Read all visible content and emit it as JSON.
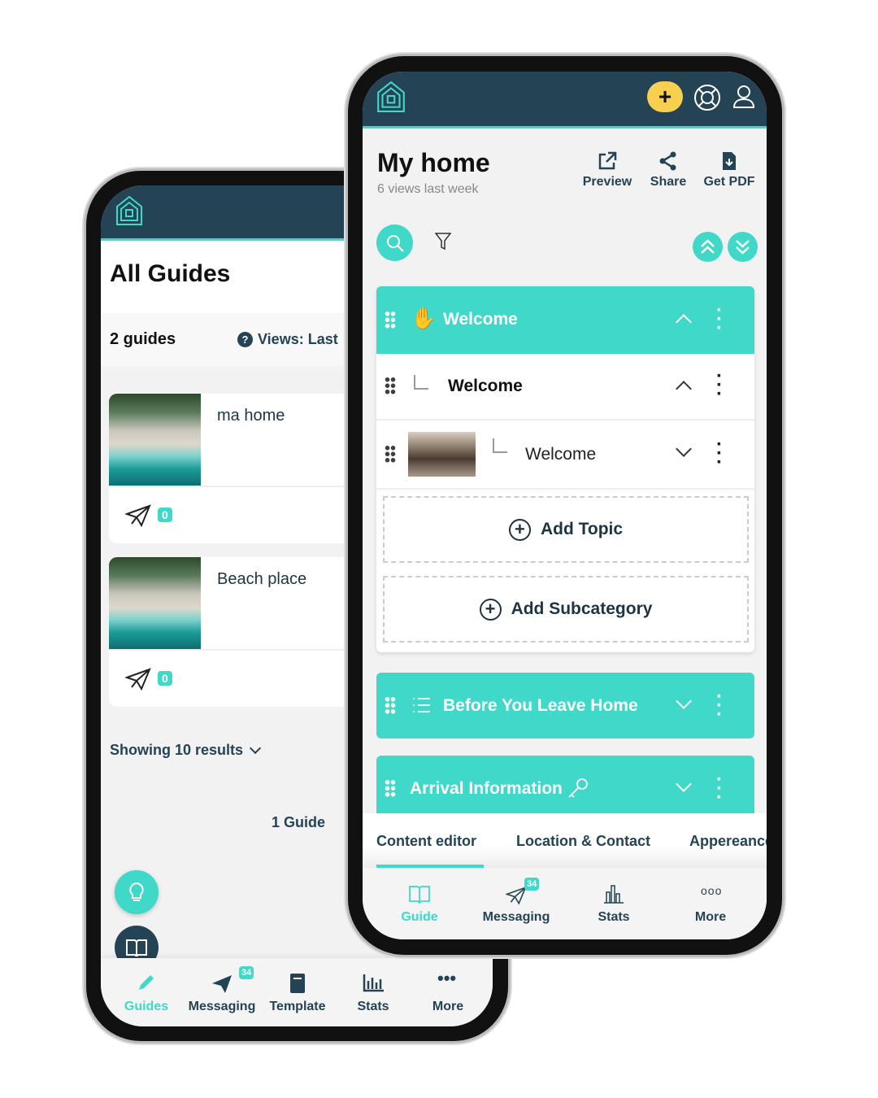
{
  "colors": {
    "header": "#244354",
    "accent": "#3fd8c9",
    "plus_button": "#f7d04f",
    "bg": "#f2f2f2"
  },
  "back_phone": {
    "title": "All Guides",
    "guide_count": "2 guides",
    "views_filter": "Views: Last",
    "guides": [
      {
        "name": "ma home",
        "message_count": "0"
      },
      {
        "name": "Beach place",
        "message_count": "0"
      }
    ],
    "showing": "Showing 10 results",
    "pagination": "1 Guide",
    "nav": [
      {
        "label": "Guides",
        "icon": "pencil-icon",
        "active": true
      },
      {
        "label": "Messaging",
        "icon": "paper-plane-icon",
        "badge": "34"
      },
      {
        "label": "Template",
        "icon": "book-icon"
      },
      {
        "label": "Stats",
        "icon": "bar-chart-icon"
      },
      {
        "label": "More",
        "icon": "more-icon"
      }
    ]
  },
  "front_phone": {
    "title": "My home",
    "subtitle": "6 views last week",
    "actions": [
      {
        "label": "Preview",
        "icon": "external-link-icon"
      },
      {
        "label": "Share",
        "icon": "share-icon"
      },
      {
        "label": "Get PDF",
        "icon": "file-download-icon"
      }
    ],
    "category": {
      "label": "Welcome",
      "icon": "hand-icon"
    },
    "subcategory": {
      "label": "Welcome"
    },
    "topic": {
      "label": "Welcome"
    },
    "add_topic": "Add Topic",
    "add_subcategory": "Add Subcategory",
    "categories": [
      {
        "label": "Before You Leave Home",
        "icon": "list-icon"
      },
      {
        "label": "Arrival Information",
        "icon": "key-icon"
      }
    ],
    "tabs": [
      {
        "label": "Content editor",
        "active": true
      },
      {
        "label": "Location & Contact"
      },
      {
        "label": "Appereance"
      }
    ],
    "nav": [
      {
        "label": "Guide",
        "icon": "book-icon",
        "active": true
      },
      {
        "label": "Messaging",
        "icon": "paper-plane-icon",
        "badge": "34"
      },
      {
        "label": "Stats",
        "icon": "bar-chart-icon"
      },
      {
        "label": "More",
        "icon": "more-icon"
      }
    ]
  }
}
